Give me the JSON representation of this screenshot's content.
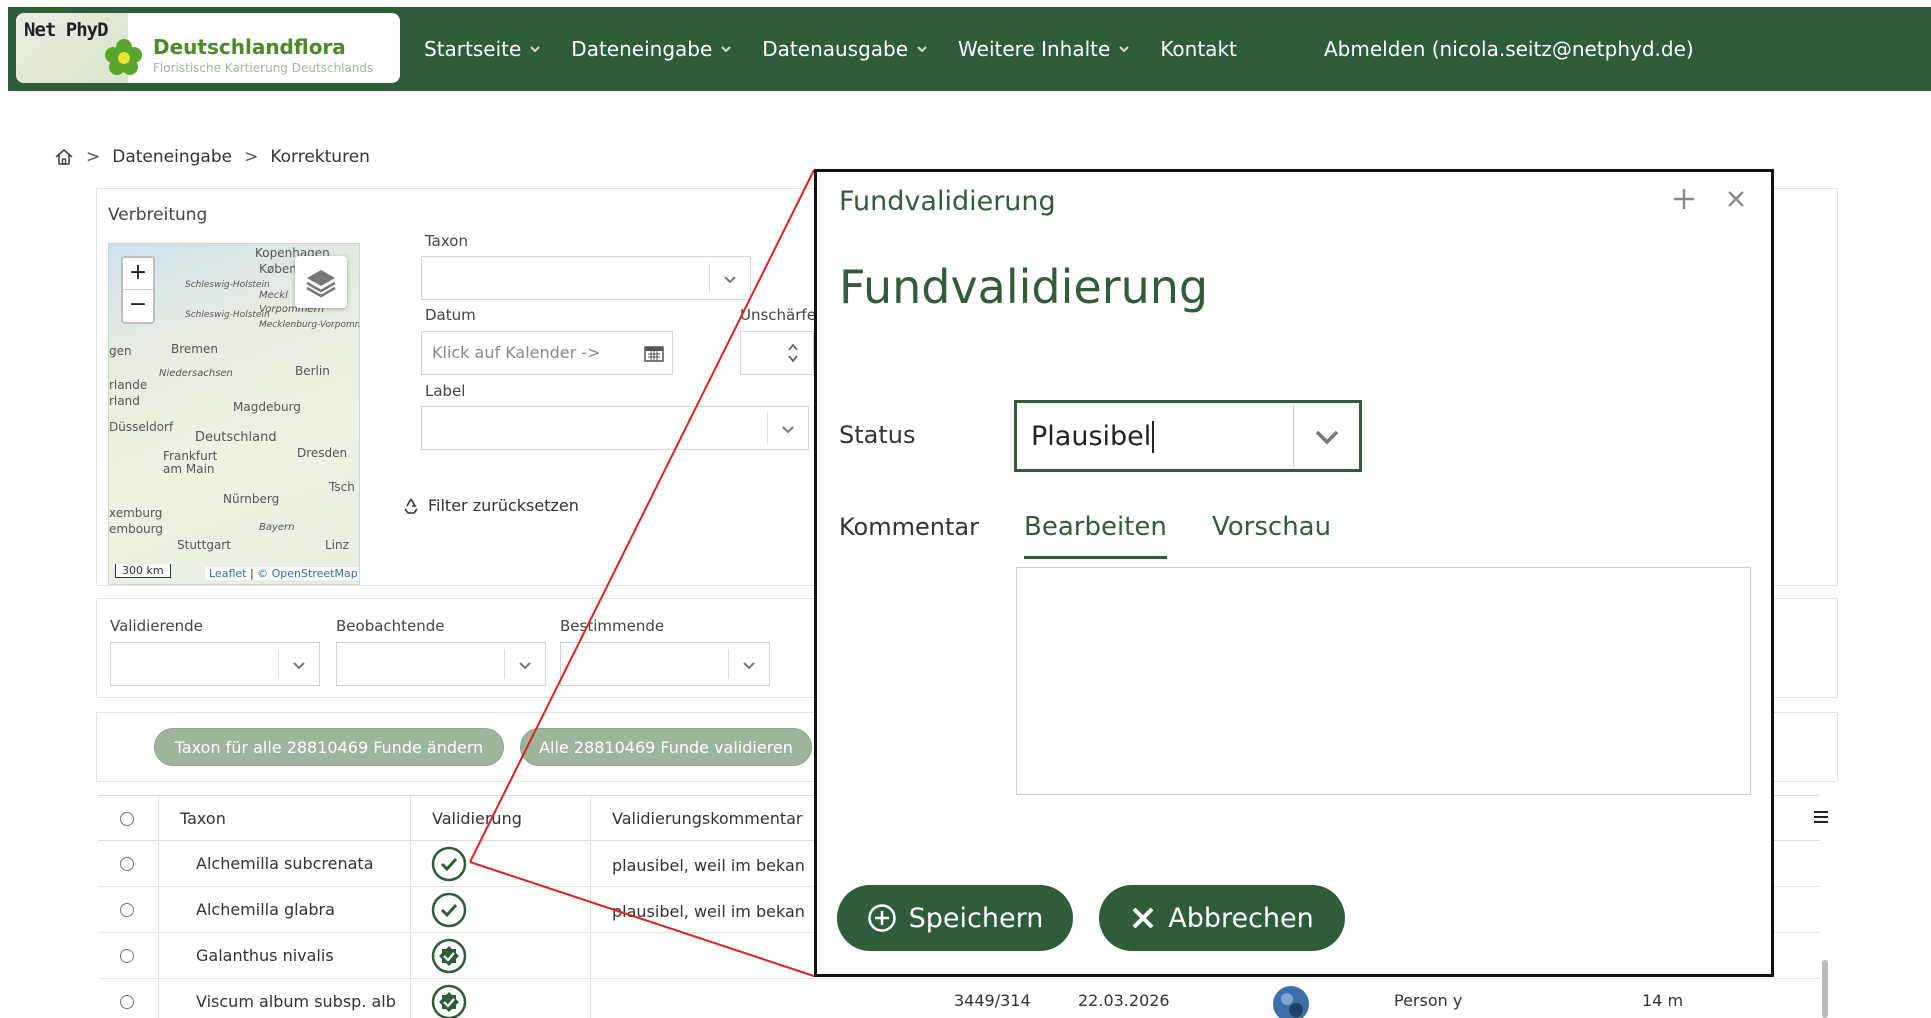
{
  "header": {
    "logo_netphyd": "Net PhyD",
    "logo_title": "Deutschlandflora",
    "logo_subtitle": "Floristische Kartierung Deutschlands",
    "nav": [
      {
        "label": "Startseite"
      },
      {
        "label": "Dateneingabe"
      },
      {
        "label": "Datenausgabe"
      },
      {
        "label": "Weitere Inhalte"
      },
      {
        "label": "Kontakt"
      }
    ],
    "logout": "Abmelden (nicola.seitz@netphyd.de)",
    "colors": {
      "bar": "#2f5d3a",
      "brand_green": "#4a8a2a"
    }
  },
  "breadcrumb": {
    "home_icon": "home-icon",
    "items": [
      "Dateneingabe",
      "Korrekturen"
    ]
  },
  "filters": {
    "verbreitung_label": "Verbreitung",
    "taxon_label": "Taxon",
    "datum_label": "Datum",
    "datum_placeholder": "Klick auf Kalender ->",
    "unschaerfe_label": "Unschärfe",
    "label_label": "Label",
    "reset_label": "Filter zurücksetzen",
    "validierende_label": "Validierende",
    "beobachtende_label": "Beobachtende",
    "bestimmende_label": "Bestimmende"
  },
  "map": {
    "places": [
      "Kopenhagen",
      "Køben",
      "Schleswig-Holstein",
      "Meckl",
      "Vorpommern",
      "Schleswig-Holstein",
      "Mecklenburg-Vorpommern",
      "Bremen",
      "gen",
      "Niedersachsen",
      "Berlin",
      "rlande",
      "rland",
      "Magdeburg",
      "Düsseldorf",
      "Deutschland",
      "Dresden",
      "Frankfurt am Main",
      "Tsch",
      "Nürnberg",
      "xemburg",
      "embourg",
      "Bayern",
      "Stuttgart",
      "Linz"
    ],
    "scale": "300 km",
    "attribution_leaflet": "Leaflet",
    "attribution_osm": "© OpenStreetMap"
  },
  "actions": {
    "change_taxon": "Taxon für alle 28810469 Funde ändern",
    "validate_all": "Alle 28810469 Funde validieren"
  },
  "table": {
    "headers": {
      "taxon": "Taxon",
      "validation": "Validierung",
      "comment": "Validierungskommentar"
    },
    "rows": [
      {
        "taxon": "Alchemilla subcrenata",
        "comment": "plausibel, weil im bekan",
        "icon": "check-circle-icon"
      },
      {
        "taxon": "Alchemilla glabra",
        "comment": "plausibel, weil im bekan",
        "icon": "check-circle-icon"
      },
      {
        "taxon": "Galanthus nivalis",
        "comment": "",
        "icon": "badge-check-icon"
      },
      {
        "taxon": "Viscum album subsp. alb",
        "comment": "",
        "icon": "badge-check-icon",
        "extra": {
          "code": "3449/314",
          "date": "22.03.2026",
          "person": "Person y",
          "precision": "14 m"
        }
      }
    ]
  },
  "modal": {
    "header": "Fundvalidierung",
    "title": "Fundvalidierung",
    "status_label": "Status",
    "status_value": "Plausibel",
    "comment_label": "Kommentar",
    "tab_edit": "Bearbeiten",
    "tab_preview": "Vorschau",
    "comment_value": "",
    "save": "Speichern",
    "cancel": "Abbrechen",
    "callout_color": "#e02020"
  }
}
